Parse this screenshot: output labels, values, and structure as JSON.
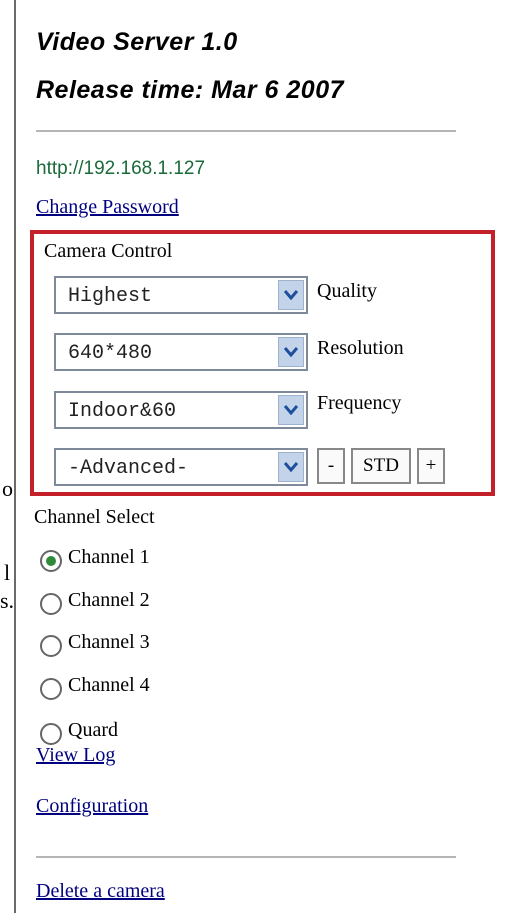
{
  "stray_text": {
    "o": "o",
    "l": "l",
    "s": "s."
  },
  "header": {
    "title_line1": "Video Server 1.0",
    "title_line2": "Release time: Mar 6 2007"
  },
  "server_url": "http://192.168.1.127",
  "links": {
    "change_password": "Change Password",
    "view_log": "View Log",
    "configuration": "Configuration",
    "delete_camera": "Delete a camera"
  },
  "camera_control": {
    "heading": "Camera Control",
    "quality": {
      "value": "Highest",
      "label": "Quality"
    },
    "resolution": {
      "value": "640*480",
      "label": "Resolution"
    },
    "frequency": {
      "value": "Indoor&60",
      "label": "Frequency"
    },
    "advanced": {
      "value": "-Advanced-"
    },
    "buttons": {
      "minus": "-",
      "std": "STD",
      "plus": "+"
    }
  },
  "channel_select": {
    "heading": "Channel Select",
    "options": [
      {
        "label": "Channel 1",
        "selected": true
      },
      {
        "label": "Channel 2",
        "selected": false
      },
      {
        "label": "Channel 3",
        "selected": false
      },
      {
        "label": "Channel 4",
        "selected": false
      },
      {
        "label": "Quard",
        "selected": false
      }
    ]
  },
  "colors": {
    "border_red": "#c4202a",
    "link_blue": "#000080",
    "url_green": "#1a6a3a",
    "dropdown_arrow_bg": "#c3d4ea"
  }
}
